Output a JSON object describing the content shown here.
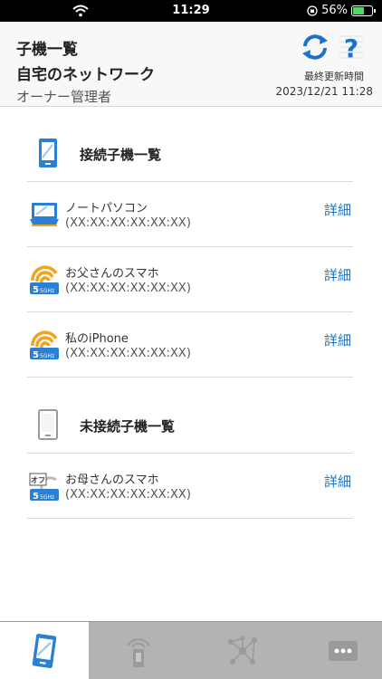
{
  "status_bar": {
    "time": "11:29",
    "battery": "56%",
    "battery_level": 0.56
  },
  "header": {
    "title": "子機一覧",
    "network": "自宅のネットワーク",
    "role": "オーナー管理者",
    "updated_label": "最終更新時間",
    "updated_time": "2023/12/21 11:28"
  },
  "connected": {
    "label": "接続子機一覧",
    "devices": [
      {
        "name": "ノートパソコン",
        "mac": "(XX:XX:XX:XX:XX:XX)",
        "detail": "詳細",
        "icon": "laptop-icon"
      },
      {
        "name": "お父さんのスマホ",
        "mac": "(XX:XX:XX:XX:XX:XX)",
        "detail": "詳細",
        "icon": "wifi-5ghz-icon",
        "band": "5GHz"
      },
      {
        "name": "私のiPhone",
        "mac": "(XX:XX:XX:XX:XX:XX)",
        "detail": "詳細",
        "icon": "wifi-5ghz-icon",
        "band": "5GHz"
      }
    ]
  },
  "disconnected": {
    "label": "未接続子機一覧",
    "devices": [
      {
        "name": "お母さんのスマホ",
        "mac": "(XX:XX:XX:XX:XX:XX)",
        "detail": "詳細",
        "icon": "offline-5ghz-icon",
        "band": "5GHz",
        "badge": "オフ"
      }
    ]
  },
  "colors": {
    "accent": "#1a73c9",
    "wifi_orange": "#f2a31b",
    "tab_bg": "#b3b3b3"
  }
}
